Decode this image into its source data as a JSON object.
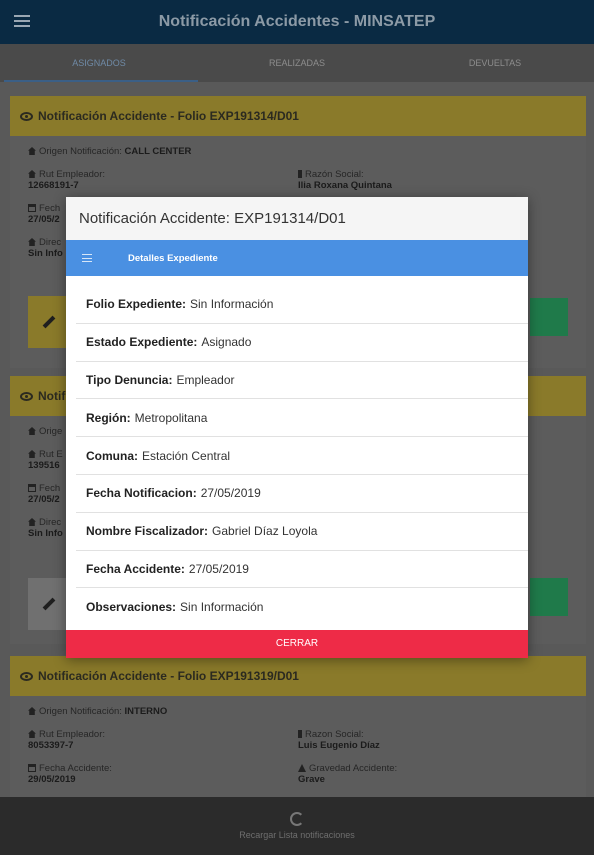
{
  "app": {
    "title": "Notificación Accidentes - MINSATEP"
  },
  "tabs": [
    {
      "label": "ASIGNADOS"
    },
    {
      "label": "REALIZADAS"
    },
    {
      "label": "DEVUELTAS"
    }
  ],
  "cards": [
    {
      "title": "Notificación Accidente - Folio EXP191314/D01",
      "origen_label": "Origen Notificación:",
      "origen_value": "CALL CENTER",
      "rut_label": "Rut Empleador:",
      "rut_value": "12668191-7",
      "razon_label": "Razón Social:",
      "razon_value": "Ilia Roxana Quintana",
      "fecha_label": "Fech",
      "fecha_value": "27/05/2",
      "direc_label": "Direc",
      "direc_value": "Sin Info"
    },
    {
      "title": "Notif",
      "origen_label": "Orige",
      "rut_label": "Rut E",
      "rut_value": "139516",
      "fecha_label": "Fech",
      "fecha_value": "27/05/2",
      "direc_label": "Direc",
      "direc_value": "Sin Info"
    },
    {
      "title": "Notificación Accidente - Folio EXP191319/D01",
      "origen_label": "Origen Notificación:",
      "origen_value": "INTERNO",
      "rut_label": "Rut Empleador:",
      "rut_value": "8053397-7",
      "razon_label": "Razon Social:",
      "razon_value": "Luis Eugenio Díaz",
      "fecha_label": "Fecha Accidente:",
      "fecha_value": "29/05/2019",
      "gravedad_label": "Gravedad Accidente:",
      "gravedad_value": "Grave"
    }
  ],
  "modal": {
    "title": "Notificación Accidente: EXP191314/D01",
    "tab_label": "Detalles Expediente",
    "details": [
      {
        "label": "Folio Expediente:",
        "value": "Sin Información"
      },
      {
        "label": "Estado Expediente:",
        "value": "Asignado"
      },
      {
        "label": "Tipo Denuncia:",
        "value": "Empleador"
      },
      {
        "label": "Región:",
        "value": "Metropolitana"
      },
      {
        "label": "Comuna:",
        "value": "Estación Central"
      },
      {
        "label": "Fecha Notificacion:",
        "value": "27/05/2019"
      },
      {
        "label": "Nombre Fiscalizador:",
        "value": "Gabriel Díaz Loyola"
      },
      {
        "label": "Fecha Accidente:",
        "value": "27/05/2019"
      },
      {
        "label": "Observaciones:",
        "value": "Sin Información"
      }
    ],
    "close_label": "CERRAR"
  },
  "bottom": {
    "reload_label": "Recargar Lista notificaciones"
  },
  "colors": {
    "header": "#0a2a43",
    "card_accent": "#f2c12e",
    "modal_tab": "#4a90e2",
    "close": "#ee2b47"
  }
}
